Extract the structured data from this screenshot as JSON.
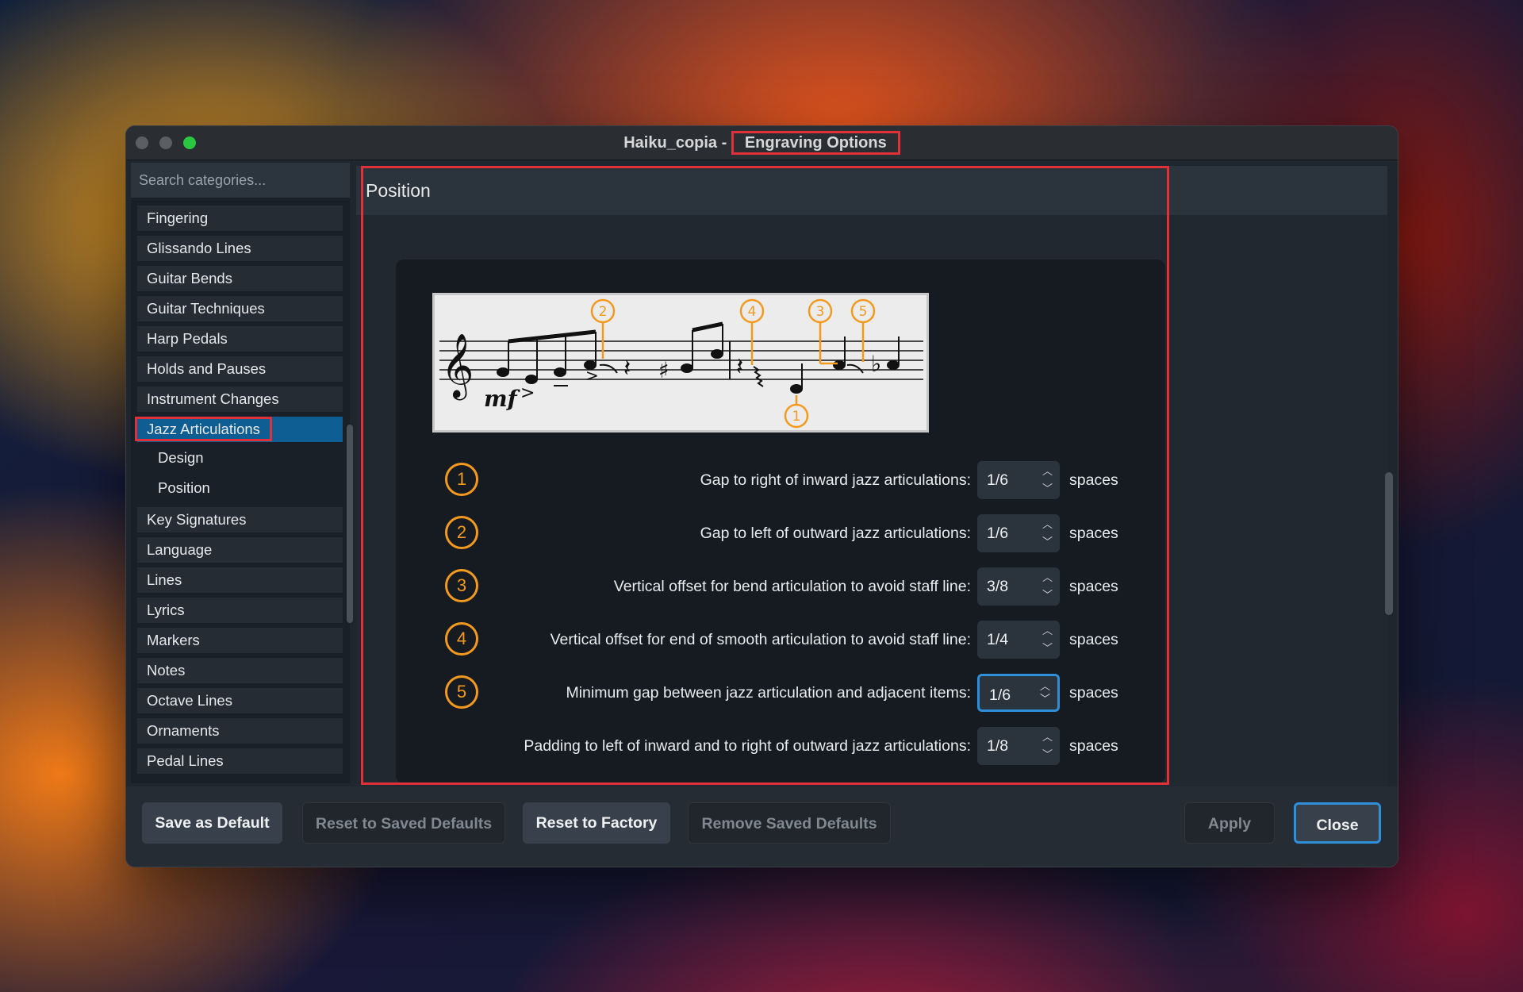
{
  "window": {
    "title_prefix": "Haiku_copia - ",
    "title_highlight": "Engraving Options"
  },
  "sidebar": {
    "search_placeholder": "Search categories...",
    "items": [
      {
        "label": "Fingering"
      },
      {
        "label": "Glissando Lines"
      },
      {
        "label": "Guitar Bends"
      },
      {
        "label": "Guitar Techniques"
      },
      {
        "label": "Harp Pedals"
      },
      {
        "label": "Holds and Pauses"
      },
      {
        "label": "Instrument Changes"
      },
      {
        "label": "Jazz Articulations",
        "selected": true
      },
      {
        "label": "Key Signatures"
      },
      {
        "label": "Language"
      },
      {
        "label": "Lines"
      },
      {
        "label": "Lyrics"
      },
      {
        "label": "Markers"
      },
      {
        "label": "Notes"
      },
      {
        "label": "Octave Lines"
      },
      {
        "label": "Ornaments"
      },
      {
        "label": "Pedal Lines"
      }
    ],
    "subitems": [
      {
        "label": "Design"
      },
      {
        "label": "Position"
      }
    ]
  },
  "content": {
    "section_title": "Position",
    "score": {
      "dynamic": "mf",
      "callouts": [
        "1",
        "2",
        "3",
        "4",
        "5"
      ]
    },
    "rows": [
      {
        "num": "1",
        "label": "Gap to right of inward jazz articulations:",
        "value": "1/6",
        "unit": "spaces"
      },
      {
        "num": "2",
        "label": "Gap to left of outward jazz articulations:",
        "value": "1/6",
        "unit": "spaces"
      },
      {
        "num": "3",
        "label": "Vertical offset for bend articulation to avoid staff line:",
        "value": "3/8",
        "unit": "spaces"
      },
      {
        "num": "4",
        "label": "Vertical offset for end of smooth articulation to avoid staff line:",
        "value": "1/4",
        "unit": "spaces"
      },
      {
        "num": "5",
        "label": "Minimum gap between jazz articulation and adjacent items:",
        "value": "1/6",
        "unit": "spaces",
        "focused": true
      },
      {
        "num": "",
        "label": "Padding to left of inward and to right of outward jazz articulations:",
        "value": "1/8",
        "unit": "spaces"
      }
    ]
  },
  "footer": {
    "save_default": "Save as Default",
    "reset_saved": "Reset to Saved Defaults",
    "reset_factory": "Reset to Factory",
    "remove_saved": "Remove Saved Defaults",
    "apply": "Apply",
    "close": "Close"
  },
  "colors": {
    "accent_orange": "#f39a1e",
    "highlight_red": "#e0303a",
    "selection_blue": "#0e5d93",
    "focus_blue": "#2f8fd8"
  }
}
